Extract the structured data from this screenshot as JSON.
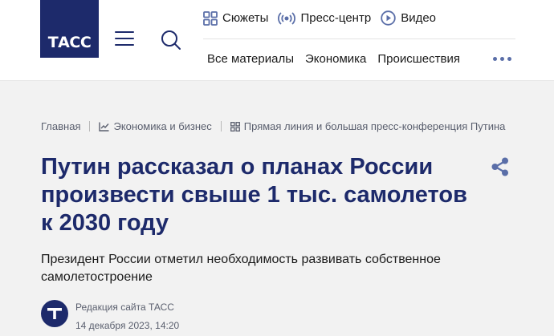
{
  "header": {
    "logo": "ТАСС",
    "top_nav": [
      {
        "label": "Сюжеты",
        "icon": "grid-icon"
      },
      {
        "label": "Пресс-центр",
        "icon": "broadcast-icon"
      },
      {
        "label": "Видео",
        "icon": "play-icon"
      }
    ],
    "sub_nav": [
      "Все материалы",
      "Экономика",
      "Происшествия"
    ]
  },
  "breadcrumbs": [
    {
      "label": "Главная",
      "icon": ""
    },
    {
      "label": "Экономика и бизнес",
      "icon": "chart-icon"
    },
    {
      "label": "Прямая линия и большая пресс-конференция Путина",
      "icon": "grid-icon"
    }
  ],
  "article": {
    "title": "Путин рассказал о планах России произвести свыше 1 тыс. самолетов к 2030 году",
    "lead": "Президент России отметил необходимость развивать собственное самолетостроение",
    "author": "Редакция сайта ТАСС",
    "date": "14 декабря 2023, 14:20"
  },
  "colors": {
    "brand": "#1d2a6b",
    "accent": "#5a6ea8",
    "background": "#f2f2f2"
  }
}
